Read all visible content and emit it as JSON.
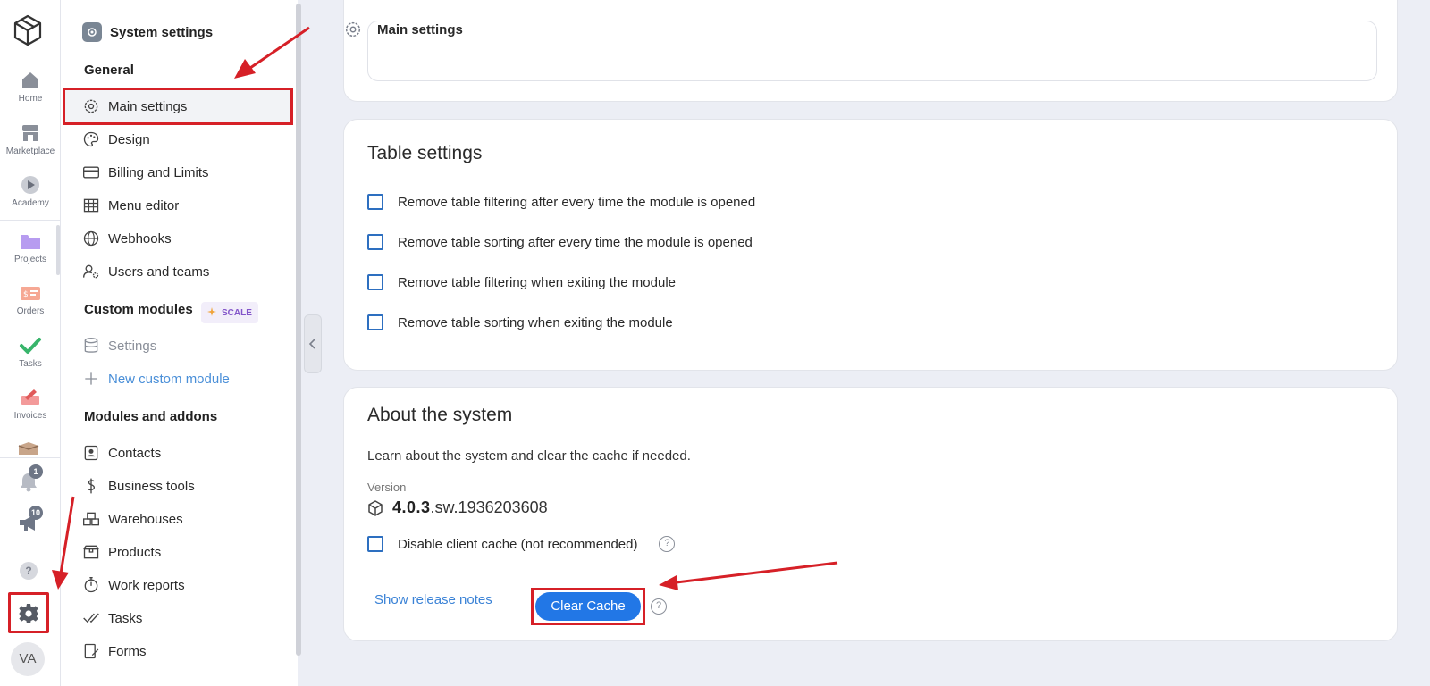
{
  "rail": {
    "items": [
      {
        "label": "Home",
        "icon": "home-icon"
      },
      {
        "label": "Marketplace",
        "icon": "store-icon"
      },
      {
        "label": "Academy",
        "icon": "play-icon"
      },
      {
        "label": "Projects",
        "icon": "folder-icon"
      },
      {
        "label": "Orders",
        "icon": "orders-icon"
      },
      {
        "label": "Tasks",
        "icon": "check-icon"
      },
      {
        "label": "Invoices",
        "icon": "invoice-icon"
      }
    ],
    "notifications_count": "1",
    "announcements_count": "10",
    "help_glyph": "?",
    "avatar_initials": "VA"
  },
  "sidebar": {
    "title": "System settings",
    "general_label": "General",
    "general_items": [
      "Main settings",
      "Design",
      "Billing and Limits",
      "Menu editor",
      "Webhooks",
      "Users and teams"
    ],
    "custom_label": "Custom modules",
    "scale_badge": "SCALE",
    "custom_items": [
      "Settings",
      "New custom module"
    ],
    "modules_label": "Modules and addons",
    "modules_items": [
      "Contacts",
      "Business tools",
      "Warehouses",
      "Products",
      "Work reports",
      "Tasks",
      "Forms"
    ]
  },
  "header": {
    "title": "Main settings"
  },
  "table_settings": {
    "title": "Table settings",
    "options": [
      "Remove table filtering after every time the module is opened",
      "Remove table sorting after every time the module is opened",
      "Remove table filtering when exiting the module",
      "Remove table sorting when exiting the module"
    ]
  },
  "about": {
    "title": "About the system",
    "description": "Learn about the system and clear the cache if needed.",
    "version_label": "Version",
    "version_main": "4.0.3",
    "version_suffix": ".sw.1936203608",
    "disable_cache_label": "Disable client cache (not recommended)",
    "help_glyph": "?",
    "release_notes_label": "Show release notes",
    "clear_cache_label": "Clear Cache"
  },
  "colors": {
    "accent": "#2277e6",
    "annotation": "#d62027",
    "link": "#3a82d6"
  }
}
